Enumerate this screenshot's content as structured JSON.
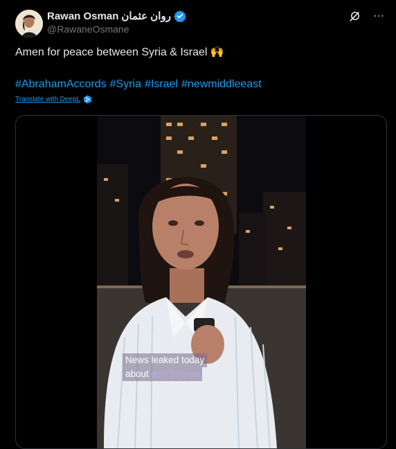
{
  "author": {
    "display_name": "Rawan Osman",
    "display_name_arabic": "روان عثمان",
    "handle": "@RawaneOsmane",
    "verified": true,
    "avatar_icon": "avatar-photo"
  },
  "tweet": {
    "text": "Amen for peace between Syria & Israel 🙌",
    "hashtags": [
      "#AbrahamAccords",
      "#Syria",
      "#Israel",
      "#newmiddleeast"
    ],
    "translate_label": "Translate with DeepL"
  },
  "video": {
    "caption_line1": "News leaked today",
    "caption_line2_prefix": "about ",
    "caption_line2_highlight": "ash-Sharaa"
  },
  "icons": {
    "grok": "grok-icon",
    "more": "more-icon",
    "verified": "verified-badge-icon",
    "deepl": "deepl-icon"
  },
  "colors": {
    "background": "#000000",
    "text": "#e7e9ea",
    "muted": "#71767b",
    "link": "#1d9bf0",
    "verified": "#1d9bf0",
    "caption_bg": "#786e8c",
    "caption_highlight": "#b9a8e8"
  }
}
